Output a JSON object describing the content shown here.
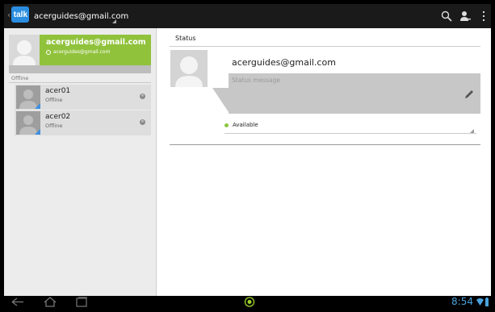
{
  "app": {
    "logo_text": "talk"
  },
  "action_bar": {
    "account": "acerguides@gmail.com",
    "icons": [
      "search-icon",
      "add-contact-icon",
      "overflow-menu-icon"
    ]
  },
  "me": {
    "name": "acerguides@gmail.com",
    "sub": "acerguides@gmail.com"
  },
  "contacts_section": {
    "header": "Offline",
    "items": [
      {
        "name": "acer01",
        "status": "Offline"
      },
      {
        "name": "acer02",
        "status": "Offline"
      }
    ]
  },
  "status_panel": {
    "title": "Status",
    "profile_name": "acerguides@gmail.com",
    "status_placeholder": "Status message",
    "availability": "Available"
  },
  "nav_bar": {
    "time": "8:54",
    "icons": [
      "back-icon",
      "home-icon",
      "recent-apps-icon",
      "app-launcher-icon",
      "wifi-icon",
      "battery-icon"
    ]
  },
  "colors": {
    "accent_green": "#90c23c",
    "available_dot": "#8cc63f",
    "clock_blue": "#4aa3df"
  }
}
